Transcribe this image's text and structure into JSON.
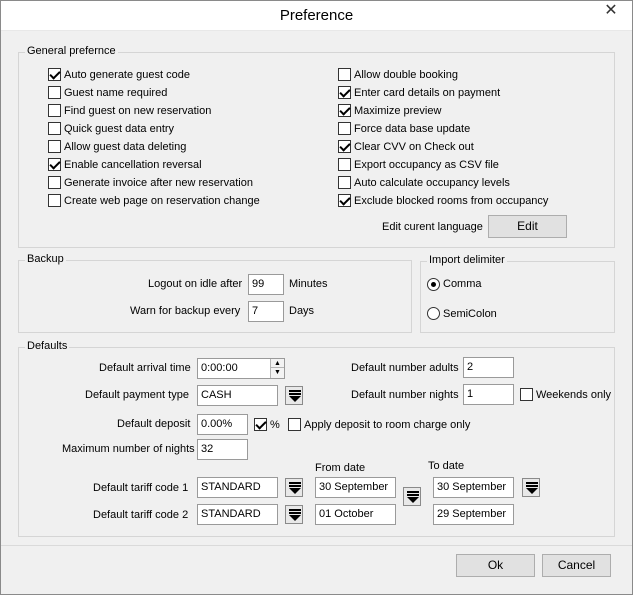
{
  "window": {
    "title": "Preference",
    "close_glyph": "✕"
  },
  "general": {
    "title": "General prefernce",
    "left": [
      {
        "label": "Auto generate guest code",
        "checked": true
      },
      {
        "label": "Guest name required",
        "checked": false
      },
      {
        "label": "Find guest on new reservation",
        "checked": false
      },
      {
        "label": "Quick guest data entry",
        "checked": false
      },
      {
        "label": "Allow guest data deleting",
        "checked": false
      },
      {
        "label": "Enable cancellation reversal",
        "checked": true
      },
      {
        "label": "Generate invoice after new reservation",
        "checked": false
      },
      {
        "label": "Create web page on reservation change",
        "checked": false
      }
    ],
    "right": [
      {
        "label": "Allow double booking",
        "checked": false
      },
      {
        "label": "Enter card details on payment",
        "checked": true
      },
      {
        "label": "Maximize preview",
        "checked": true
      },
      {
        "label": "Force data base update",
        "checked": false
      },
      {
        "label": "Clear CVV on Check out",
        "checked": true
      },
      {
        "label": "Export occupancy as CSV file",
        "checked": false
      },
      {
        "label": "Auto calculate occupancy levels",
        "checked": false
      },
      {
        "label": "Exclude blocked rooms from occupancy",
        "checked": true
      }
    ],
    "edit_language_label": "Edit curent language",
    "edit_button": "Edit"
  },
  "backup": {
    "title": "Backup",
    "logout_label": "Logout on idle after",
    "logout_value": "99",
    "logout_unit": "Minutes",
    "warn_label": "Warn for backup every",
    "warn_value": "7",
    "warn_unit": "Days"
  },
  "import_delimiter": {
    "title": "Import delimiter",
    "options": [
      {
        "label": "Comma",
        "selected": true
      },
      {
        "label": "SemiColon",
        "selected": false
      }
    ]
  },
  "defaults": {
    "title": "Defaults",
    "arrival_time_label": "Default arrival time",
    "arrival_time_value": "0:00:00",
    "payment_type_label": "Default payment type",
    "payment_type_value": "CASH",
    "deposit_label": "Default deposit",
    "deposit_value": "0.00%",
    "deposit_percent_label": "%",
    "deposit_percent_checked": true,
    "apply_deposit_label": "Apply deposit to room charge only",
    "apply_deposit_checked": false,
    "max_nights_label": "Maximum number of nights",
    "max_nights_value": "32",
    "adults_label": "Default number adults",
    "adults_value": "2",
    "nights_label": "Default number nights",
    "nights_value": "1",
    "weekends_label": "Weekends only",
    "weekends_checked": false,
    "from_date_header": "From date",
    "to_date_header": "To date",
    "tariff1_label": "Default tariff code 1",
    "tariff1_value": "STANDARD",
    "tariff1_from": "30 September",
    "tariff1_to": "30 September",
    "tariff2_label": "Default tariff code 2",
    "tariff2_value": "STANDARD",
    "tariff2_from": "01 October",
    "tariff2_to": "29 September"
  },
  "footer": {
    "ok": "Ok",
    "cancel": "Cancel"
  }
}
